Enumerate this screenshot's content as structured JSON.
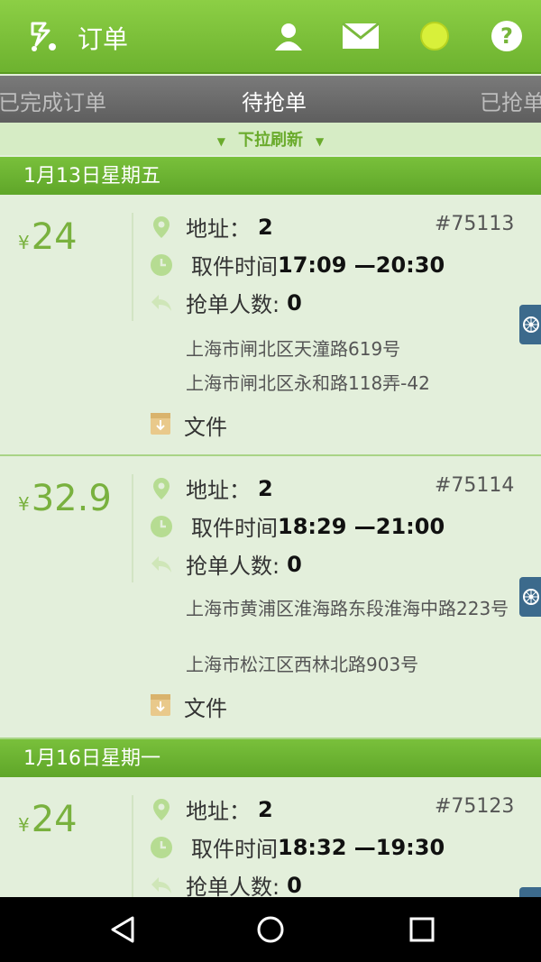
{
  "appbar": {
    "title": "订单",
    "icons": [
      "logo-icon",
      "user-icon",
      "mail-icon",
      "status-dot-icon",
      "help-icon"
    ],
    "accent": "#6db22f"
  },
  "tabs": [
    {
      "label": "已完成订单"
    },
    {
      "label": "待抢单"
    },
    {
      "label": "已抢单"
    }
  ],
  "refresh_label": "下拉刷新",
  "groups": [
    {
      "date": "1月13日星期五",
      "orders": [
        {
          "price_symbol": "¥",
          "price": "24",
          "addr_label": "地址：",
          "addr_count": "2",
          "order_no": "#75113",
          "pickup_label": "取件时间",
          "pickup_time": "17:09 —20:30",
          "grab_label": "抢单人数:",
          "grab_count": "0",
          "addresses": [
            "上海市闸北区天潼路619号",
            "上海市闸北区永和路118弄-42"
          ],
          "file_label": "文件"
        },
        {
          "price_symbol": "¥",
          "price": "32.9",
          "addr_label": "地址：",
          "addr_count": "2",
          "order_no": "#75114",
          "pickup_label": "取件时间",
          "pickup_time": "18:29 —21:00",
          "grab_label": "抢单人数:",
          "grab_count": "0",
          "addresses": [
            "上海市黄浦区淮海路东段淮海中路223号",
            "上海市松江区西林北路903号"
          ],
          "file_label": "文件"
        }
      ]
    },
    {
      "date": "1月16日星期一",
      "orders": [
        {
          "price_symbol": "¥",
          "price": "24",
          "addr_label": "地址：",
          "addr_count": "2",
          "order_no": "#75123",
          "pickup_label": "取件时间",
          "pickup_time": "18:32 —19:30",
          "grab_label": "抢单人数:",
          "grab_count": "0"
        }
      ]
    }
  ],
  "navbar": {
    "icons": [
      "back-icon",
      "home-icon",
      "recents-icon"
    ]
  }
}
